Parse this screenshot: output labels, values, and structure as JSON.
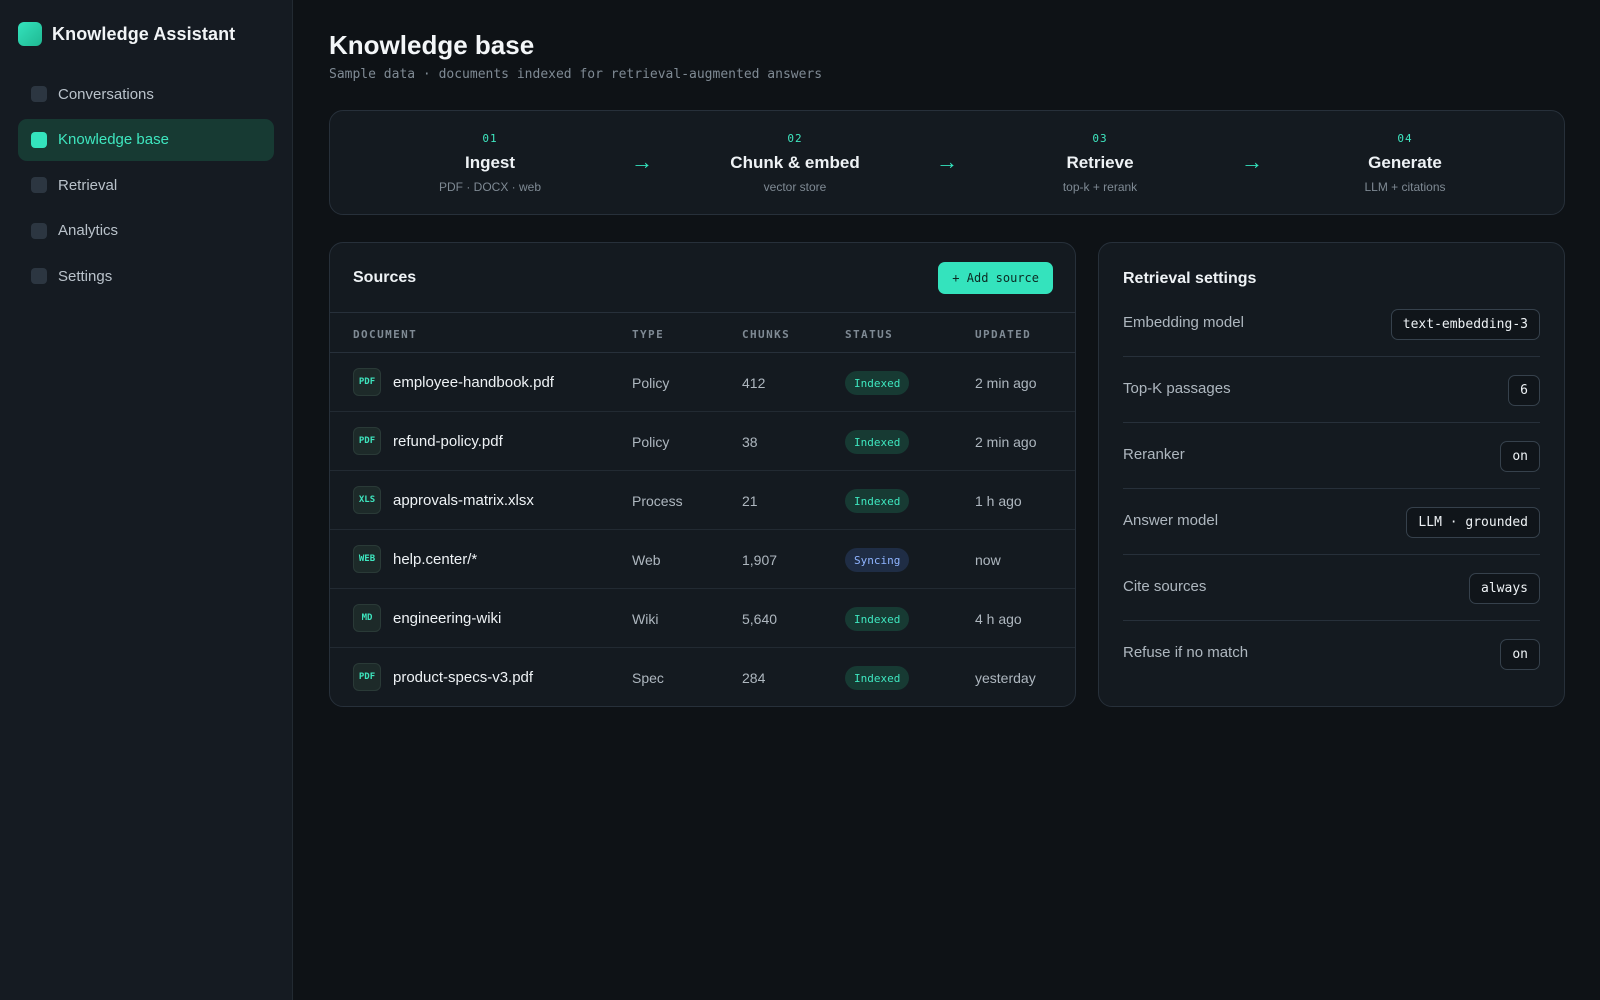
{
  "app": {
    "name": "Knowledge Assistant"
  },
  "nav": [
    {
      "label": "Conversations",
      "active": false
    },
    {
      "label": "Knowledge base",
      "active": true
    },
    {
      "label": "Retrieval",
      "active": false
    },
    {
      "label": "Analytics",
      "active": false
    },
    {
      "label": "Settings",
      "active": false
    }
  ],
  "page": {
    "title": "Knowledge base",
    "subtitle": "Sample data · documents indexed for retrieval-augmented answers"
  },
  "pipeline": [
    {
      "num": "01",
      "title": "Ingest",
      "desc": "PDF · DOCX · web"
    },
    {
      "num": "02",
      "title": "Chunk & embed",
      "desc": "vector store"
    },
    {
      "num": "03",
      "title": "Retrieve",
      "desc": "top-k + rerank"
    },
    {
      "num": "04",
      "title": "Generate",
      "desc": "LLM + citations"
    }
  ],
  "pipeline_arrow": "→",
  "sources": {
    "title": "Sources",
    "add_label": "+ Add source",
    "columns": [
      "DOCUMENT",
      "TYPE",
      "CHUNKS",
      "STATUS",
      "UPDATED"
    ],
    "rows": [
      {
        "icon": "PDF",
        "name": "employee-handbook.pdf",
        "type": "Policy",
        "chunks": "412",
        "status": "Indexed",
        "updated": "2 min ago"
      },
      {
        "icon": "PDF",
        "name": "refund-policy.pdf",
        "type": "Policy",
        "chunks": "38",
        "status": "Indexed",
        "updated": "2 min ago"
      },
      {
        "icon": "XLS",
        "name": "approvals-matrix.xlsx",
        "type": "Process",
        "chunks": "21",
        "status": "Indexed",
        "updated": "1 h ago"
      },
      {
        "icon": "WEB",
        "name": "help.center/*",
        "type": "Web",
        "chunks": "1,907",
        "status": "Syncing",
        "updated": "now"
      },
      {
        "icon": "MD",
        "name": "engineering-wiki",
        "type": "Wiki",
        "chunks": "5,640",
        "status": "Indexed",
        "updated": "4 h ago"
      },
      {
        "icon": "PDF",
        "name": "product-specs-v3.pdf",
        "type": "Spec",
        "chunks": "284",
        "status": "Indexed",
        "updated": "yesterday"
      }
    ]
  },
  "settings": {
    "title": "Retrieval settings",
    "rows": [
      {
        "label": "Embedding model",
        "value": "text-embedding-3"
      },
      {
        "label": "Top-K passages",
        "value": "6"
      },
      {
        "label": "Reranker",
        "value": "on"
      },
      {
        "label": "Answer model",
        "value": "LLM · grounded"
      },
      {
        "label": "Cite sources",
        "value": "always"
      },
      {
        "label": "Refuse if no match",
        "value": "on"
      }
    ]
  },
  "colors": {
    "accent": "#34e3bd",
    "background": "#0e1216",
    "sidebar": "#151b22",
    "card": "#141a20",
    "syncing": "#8fb4ff"
  }
}
